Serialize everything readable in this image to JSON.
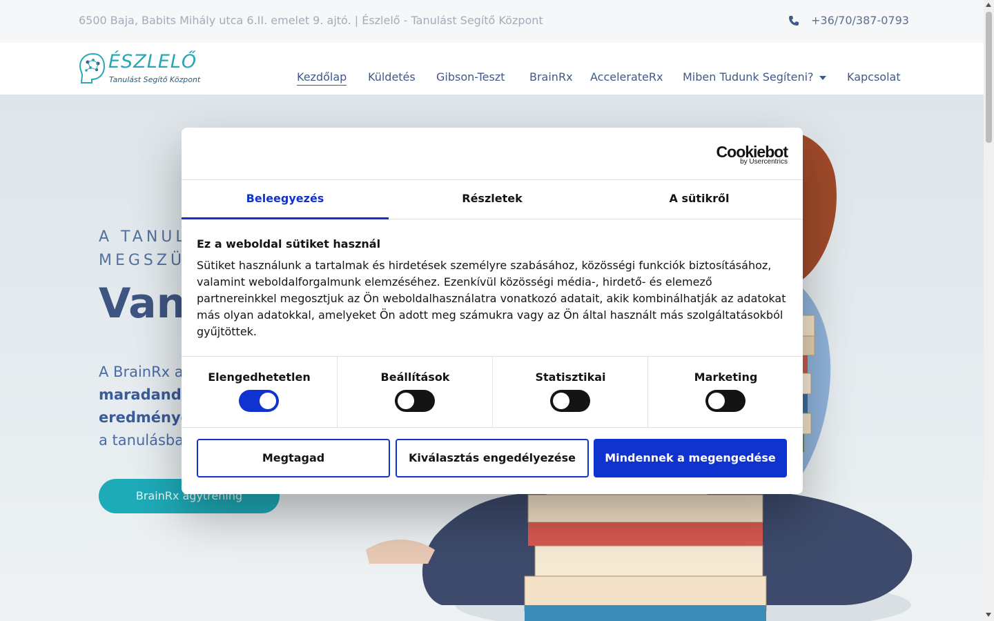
{
  "topbar": {
    "address": "6500 Baja, Babits Mihály utca 6.II. emelet 9. ajtó. | Észlelő - Tanulást Segítő Központ",
    "phone": "+36/70/387-0793"
  },
  "logo": {
    "brand": "ÉSZLELŐ",
    "tagline": "Tanulást Segítő Központ"
  },
  "nav": {
    "items": [
      {
        "label": "Kezdőlap"
      },
      {
        "label": "Küldetés"
      },
      {
        "label": "Gibson-Teszt"
      },
      {
        "label": "BrainRx"
      },
      {
        "label": "AccelerateRx"
      },
      {
        "label": "Miben Tudunk Segíteni?"
      },
      {
        "label": "Kapcsolat"
      }
    ]
  },
  "hero": {
    "kicker_line1": "A TANUL",
    "kicker_line2": "MEGSZÜN",
    "headline": "Van",
    "lead_line1": "A BrainRx a",
    "lead_line2": "maradand",
    "lead_line3": "eredménye",
    "lead_line4": "a tanulásba",
    "cta": "BrainRx agytréning"
  },
  "dialog": {
    "logo_main": "Cookiebot",
    "logo_by": "by Usercentrics",
    "tabs": [
      "Beleegyezés",
      "Részletek",
      "A sütikről"
    ],
    "title": "Ez a weboldal sütiket használ",
    "text": "Sütiket használunk a tartalmak és hirdetések személyre szabásához, közösségi funkciók biztosításához, valamint weboldalforgalmunk elemzéséhez. Ezenkívül közösségi média-, hirdető- és elemező partnereinkkel megosztjuk az Ön weboldalhasználatra vonatkozó adatait, akik kombinálhatják az adatokat más olyan adatokkal, amelyeket Ön adott meg számukra vagy az Ön által használt más szolgáltatásokból gyűjtöttek.",
    "toggles": [
      {
        "label": "Elengedhetetlen",
        "on": true
      },
      {
        "label": "Beállítások",
        "on": false
      },
      {
        "label": "Statisztikai",
        "on": false
      },
      {
        "label": "Marketing",
        "on": false
      }
    ],
    "buttons": {
      "deny": "Megtagad",
      "allow_selection": "Kiválasztás engedélyezése",
      "allow_all": "Mindennek a megengedése"
    }
  },
  "colors": {
    "accent": "#1032cf",
    "brand_teal": "#2aa6b5",
    "nav_text": "#3f5a84",
    "cta": "#1eabb8"
  },
  "icons": [
    "phone-icon",
    "brain-logo-icon",
    "chevron-down-icon"
  ]
}
